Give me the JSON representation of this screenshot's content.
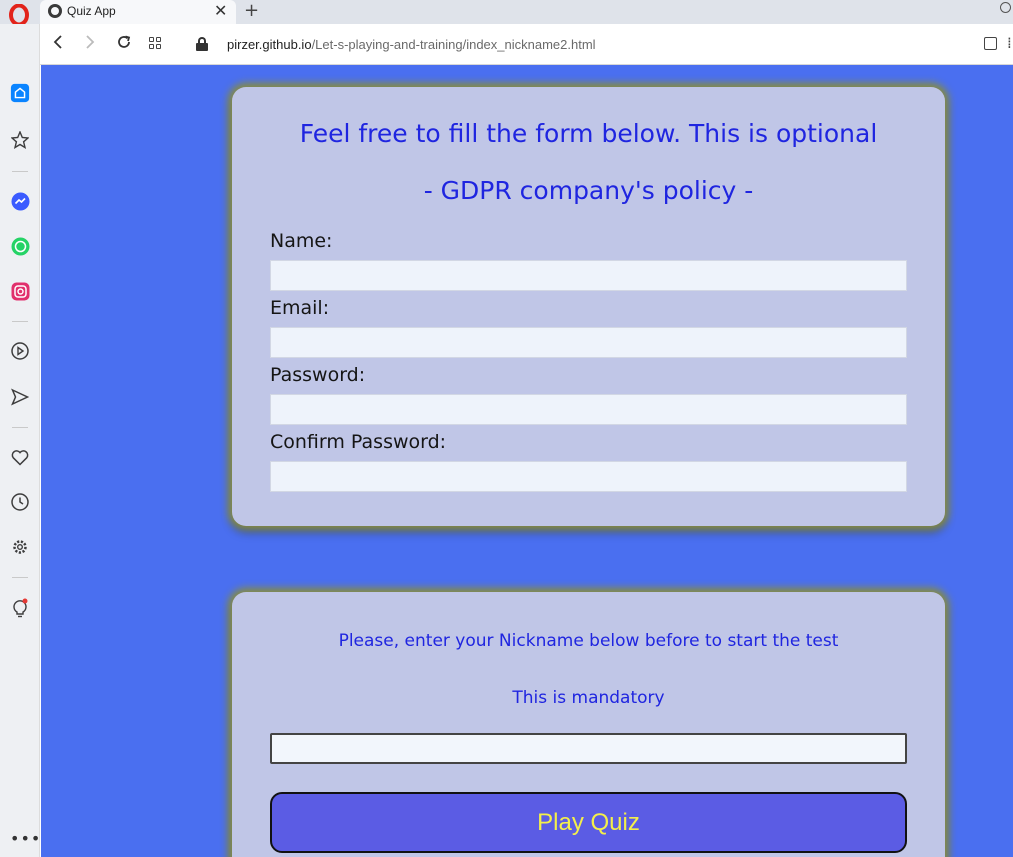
{
  "browser": {
    "tab": {
      "title": "Quiz App",
      "close": "✕"
    },
    "new_tab": "+",
    "url": {
      "host": "pirzer.github.io",
      "path": "/Let-s-playing-and-training/index_nickname2.html"
    },
    "accent": "#1a73e8"
  },
  "sidebar": {
    "items": [
      {
        "icon": "home-icon",
        "color": "#0a84ff"
      },
      {
        "icon": "speed-dial-icon"
      },
      {
        "icon": "messenger-icon",
        "color": "#3b5bff"
      },
      {
        "icon": "whatsapp-icon",
        "color": "#25d366"
      },
      {
        "icon": "instagram-icon",
        "color": "#e1306c"
      },
      {
        "icon": "player-icon"
      },
      {
        "icon": "flow-send-icon"
      },
      {
        "icon": "heart-icon"
      },
      {
        "icon": "history-icon"
      },
      {
        "icon": "settings-icon"
      },
      {
        "icon": "lightbulb-icon"
      }
    ],
    "more": "•••"
  },
  "form": {
    "heading": "Feel free to fill the form below. This is optional",
    "subheading": "- GDPR company's policy -",
    "fields": [
      {
        "label": "Name:",
        "value": ""
      },
      {
        "label": "Email:",
        "value": ""
      },
      {
        "label": "Password:",
        "value": ""
      },
      {
        "label": "Confirm Password:",
        "value": ""
      }
    ]
  },
  "nickname": {
    "prompt": "Please, enter your Nickname below before to start the test",
    "note": "This is mandatory",
    "value": "",
    "button": "Play Quiz"
  },
  "colors": {
    "page_bg": "#4a6ff0",
    "card_bg": "#c0c6e7",
    "heading_text": "#1f25e0",
    "button_bg": "#5b5ce4",
    "button_text": "#f4ef4a"
  }
}
